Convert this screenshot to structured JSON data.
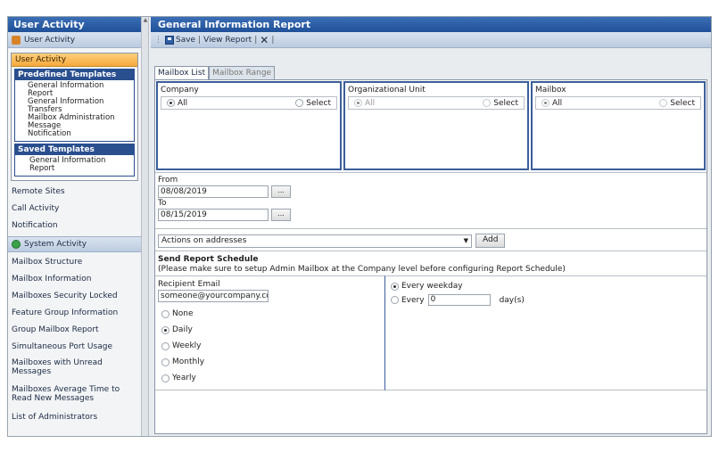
{
  "sidebar": {
    "title": "User Activity",
    "section_label": "User Activity",
    "panel_label": "User Activity",
    "predefined": {
      "heading": "Predefined Templates",
      "items": [
        "General Information",
        "Report",
        "General Information",
        "Transfers",
        "Mailbox Administration",
        "Message",
        "Notification"
      ]
    },
    "saved": {
      "heading": "Saved Templates",
      "items": [
        "General Information",
        "Report"
      ]
    },
    "links_top": [
      "Remote Sites",
      "Call Activity",
      "Notification"
    ],
    "group_label": "System Activity",
    "links_bottom": [
      "Mailbox Structure",
      "Mailbox Information",
      "Mailboxes Security Locked",
      "Feature Group Information",
      "Group Mailbox Report",
      "Simultaneous Port Usage",
      "Mailboxes with Unread Messages",
      "Mailboxes Average Time to Read New Messages",
      "List of Administrators"
    ]
  },
  "main": {
    "title": "General Information Report",
    "toolbar": {
      "save": "Save",
      "view": "View Report"
    },
    "tabs": [
      "Mailbox List",
      "Mailbox Range"
    ],
    "org": [
      {
        "title": "Company",
        "opt_all": "All",
        "opt_select": "Select"
      },
      {
        "title": "Organizational Unit",
        "opt_all": "All",
        "opt_select": "Select"
      },
      {
        "title": "Mailbox",
        "opt_all": "All",
        "opt_select": "Select"
      }
    ],
    "dates": {
      "from_label": "From",
      "from_value": "08/08/2019",
      "to_label": "To",
      "to_value": "08/15/2019",
      "picker": "..."
    },
    "actions": {
      "selected": "Actions on addresses",
      "add": "Add"
    },
    "schedule": {
      "title": "Send Report Schedule",
      "note": "(Please make sure to setup Admin Mailbox at the Company level before configuring Report Schedule)",
      "recipient_label": "Recipient Email",
      "recipient_value": "someone@yourcompany.com",
      "frequency": [
        "None",
        "Daily",
        "Weekly",
        "Monthly",
        "Yearly"
      ],
      "every_weekday": "Every weekday",
      "every": "Every",
      "every_value": "0",
      "days": "day(s)"
    }
  }
}
